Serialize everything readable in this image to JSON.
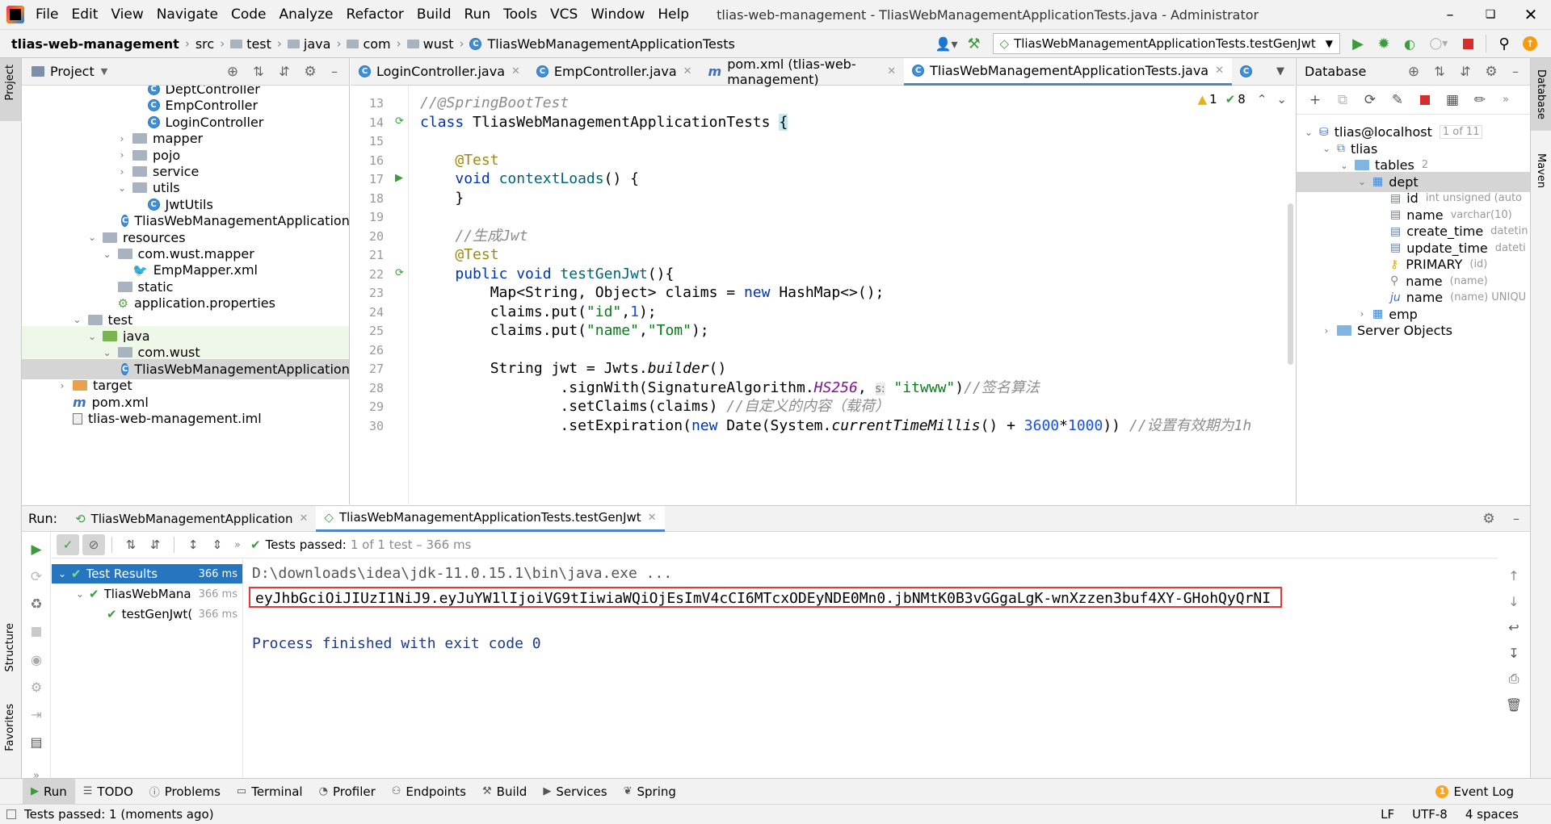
{
  "window": {
    "title": "tlias-web-management - TliasWebManagementApplicationTests.java - Administrator",
    "app_icon": "intellij-logo"
  },
  "menu": [
    "File",
    "Edit",
    "View",
    "Navigate",
    "Code",
    "Analyze",
    "Refactor",
    "Build",
    "Run",
    "Tools",
    "VCS",
    "Window",
    "Help"
  ],
  "breadcrumb": [
    "tlias-web-management",
    "src",
    "test",
    "java",
    "com",
    "wust",
    "TliasWebManagementApplicationTests"
  ],
  "run_config": "TliasWebManagementApplicationTests.testGenJwt",
  "project": {
    "title": "Project",
    "tree": [
      {
        "label": "DeptController",
        "type": "class",
        "depth": 7
      },
      {
        "label": "EmpController",
        "type": "class",
        "depth": 7
      },
      {
        "label": "LoginController",
        "type": "class",
        "depth": 7
      },
      {
        "label": "mapper",
        "type": "folder",
        "depth": 6,
        "exp": "closed"
      },
      {
        "label": "pojo",
        "type": "folder",
        "depth": 6,
        "exp": "closed"
      },
      {
        "label": "service",
        "type": "folder",
        "depth": 6,
        "exp": "closed"
      },
      {
        "label": "utils",
        "type": "folder",
        "depth": 6,
        "exp": "open"
      },
      {
        "label": "JwtUtils",
        "type": "class",
        "depth": 7
      },
      {
        "label": "TliasWebManagementApplication",
        "type": "class",
        "depth": 6
      },
      {
        "label": "resources",
        "type": "folder",
        "depth": 4,
        "exp": "open"
      },
      {
        "label": "com.wust.mapper",
        "type": "folder",
        "depth": 5,
        "exp": "open"
      },
      {
        "label": "EmpMapper.xml",
        "type": "xml",
        "depth": 6
      },
      {
        "label": "static",
        "type": "folder",
        "depth": 5
      },
      {
        "label": "application.properties",
        "type": "props",
        "depth": 5
      },
      {
        "label": "test",
        "type": "folder",
        "depth": 3,
        "exp": "open"
      },
      {
        "label": "java",
        "type": "folder-green",
        "depth": 4,
        "exp": "open"
      },
      {
        "label": "com.wust",
        "type": "folder",
        "depth": 5,
        "exp": "open"
      },
      {
        "label": "TliasWebManagementApplicationTests",
        "type": "class",
        "depth": 6,
        "selected": true
      },
      {
        "label": "target",
        "type": "folder-orange",
        "depth": 2,
        "exp": "closed"
      },
      {
        "label": "pom.xml",
        "type": "maven",
        "depth": 2
      },
      {
        "label": "tlias-web-management.iml",
        "type": "iml",
        "depth": 2
      }
    ]
  },
  "editor": {
    "tabs": [
      {
        "label": "LoginController.java",
        "icon": "class"
      },
      {
        "label": "EmpController.java",
        "icon": "class"
      },
      {
        "label": "pom.xml (tlias-web-management)",
        "icon": "maven"
      },
      {
        "label": "TliasWebManagementApplicationTests.java",
        "icon": "class",
        "active": true
      },
      {
        "label": "",
        "icon": "class"
      }
    ],
    "warnings": "1",
    "oks": "8",
    "lines": [
      {
        "n": "13",
        "html": "<span class=\"cmt\">//@SpringBootTest</span>"
      },
      {
        "n": "14",
        "html": "<span class=\"kw\">class</span> TliasWebManagementApplicationTests <span style=\"background:#c8e8ef\">{</span>",
        "gutter": "run2"
      },
      {
        "n": "15",
        "html": ""
      },
      {
        "n": "16",
        "html": "    <span class=\"ann\">@Test</span>"
      },
      {
        "n": "17",
        "html": "    <span class=\"kw\">void</span> <span class=\"fn\">contextLoads</span>() {",
        "gutter": "run"
      },
      {
        "n": "18",
        "html": "    }"
      },
      {
        "n": "19",
        "html": ""
      },
      {
        "n": "20",
        "html": "    <span class=\"cmt\">//生成Jwt</span>"
      },
      {
        "n": "21",
        "html": "    <span class=\"ann\">@Test</span>"
      },
      {
        "n": "22",
        "html": "    <span class=\"kw\">public void</span> <span class=\"fn\">testGenJwt</span>(){",
        "gutter": "run2"
      },
      {
        "n": "23",
        "html": "        Map&lt;String, Object&gt; claims = <span class=\"kw\">new</span> HashMap&lt;&gt;();"
      },
      {
        "n": "24",
        "html": "        claims.put(<span class=\"str\">\"id\"</span>,<span class=\"num\">1</span>);"
      },
      {
        "n": "25",
        "html": "        claims.put(<span class=\"str\">\"name\"</span>,<span class=\"str\">\"Tom\"</span>);"
      },
      {
        "n": "26",
        "html": ""
      },
      {
        "n": "27",
        "html": "        String jwt = Jwts.<span class=\"ital\">builder</span>()"
      },
      {
        "n": "28",
        "html": "                .signWith(SignatureAlgorithm.<span class=\"sta\">HS256</span>, <span style=\"background:#ececec;color:#777;font-size:14px;font-family:'DejaVu Sans',sans-serif\">s:</span> <span class=\"str\">\"itwww\"</span>)<span class=\"cmt\">//签名算法</span>"
      },
      {
        "n": "29",
        "html": "                .setClaims(claims) <span class=\"cmt\">//自定义的内容（载荷）</span>"
      },
      {
        "n": "30",
        "html": "                .setExpiration(<span class=\"kw\">new</span> Date(System.<span class=\"ital\">currentTimeMillis</span>() + <span class=\"num\">3600</span>*<span class=\"num\">1000</span>)) <span class=\"cmt\">//设置有效期为1h</span>"
      }
    ]
  },
  "database": {
    "title": "Database",
    "tree": [
      {
        "label": "tlias@localhost",
        "extra": "1 of 11",
        "type": "ds",
        "depth": 0,
        "exp": "open"
      },
      {
        "label": "tlias",
        "extra": "",
        "type": "schema",
        "depth": 1,
        "exp": "open"
      },
      {
        "label": "tables",
        "extra": "2",
        "type": "folder",
        "depth": 2,
        "exp": "open"
      },
      {
        "label": "dept",
        "extra": "",
        "type": "table",
        "depth": 3,
        "exp": "open",
        "selected": true
      },
      {
        "label": "id",
        "extra": "int unsigned (auto",
        "type": "col",
        "depth": 4
      },
      {
        "label": "name",
        "extra": "varchar(10)",
        "type": "col",
        "depth": 4
      },
      {
        "label": "create_time",
        "extra": "datetin",
        "type": "col",
        "depth": 4
      },
      {
        "label": "update_time",
        "extra": "dateti",
        "type": "col",
        "depth": 4
      },
      {
        "label": "PRIMARY",
        "extra": "(id)",
        "type": "key",
        "depth": 4
      },
      {
        "label": "name",
        "extra": "(name)",
        "type": "idx",
        "depth": 4
      },
      {
        "label": "name",
        "extra": "(name) UNIQU",
        "type": "uq",
        "depth": 4
      },
      {
        "label": "emp",
        "extra": "",
        "type": "table",
        "depth": 3,
        "exp": "closed"
      },
      {
        "label": "Server Objects",
        "extra": "",
        "type": "folder",
        "depth": 1,
        "exp": "closed"
      }
    ]
  },
  "run": {
    "label": "Run:",
    "tabs": [
      {
        "label": "TliasWebManagementApplication",
        "active": false
      },
      {
        "label": "TliasWebManagementApplicationTests.testGenJwt",
        "active": true
      }
    ],
    "status_main": "Tests passed:",
    "status_rest": "1 of 1 test – 366 ms",
    "results": [
      {
        "label": "Test Results",
        "time": "366 ms",
        "depth": 0,
        "selected": true
      },
      {
        "label": "TliasWebMana",
        "time": "366 ms",
        "depth": 1
      },
      {
        "label": "testGenJwt(",
        "time": "366 ms",
        "depth": 2
      }
    ],
    "console": [
      "D:\\downloads\\idea\\jdk-11.0.15.1\\bin\\java.exe ...",
      "eyJhbGciOiJIUzI1NiJ9.eyJuYW1lIjoiVG9tIiwiaWQiOjEsImV4cCI6MTcxODEyNDE0Mn0.jbNMtK0B3vGGgaLgK-wnXzzen3buf4XY-GHohQyQrNI",
      "",
      "Process finished with exit code 0"
    ]
  },
  "bottom_tools": [
    {
      "label": "Run",
      "icon": "play-icon",
      "active": true
    },
    {
      "label": "TODO",
      "icon": "list-icon"
    },
    {
      "label": "Problems",
      "icon": "problems-icon"
    },
    {
      "label": "Terminal",
      "icon": "terminal-icon"
    },
    {
      "label": "Profiler",
      "icon": "profiler-icon"
    },
    {
      "label": "Endpoints",
      "icon": "endpoints-icon"
    },
    {
      "label": "Build",
      "icon": "hammer-icon"
    },
    {
      "label": "Services",
      "icon": "services-icon"
    },
    {
      "label": "Spring",
      "icon": "spring-icon"
    }
  ],
  "event_log": {
    "label": "Event Log",
    "count": "1"
  },
  "status": {
    "left": "Tests passed: 1 (moments ago)",
    "lf": "LF",
    "enc": "UTF-8",
    "indent": "4 spaces"
  },
  "left_strip": {
    "project": "Project",
    "structure": "Structure",
    "favorites": "Favorites"
  },
  "right_strip": {
    "database": "Database",
    "maven": "Maven"
  },
  "colors": {
    "accent": "#4a86c8",
    "selection": "#d5d5d5",
    "highlight_border": "#e53935",
    "pass": "#3d9b3d"
  }
}
